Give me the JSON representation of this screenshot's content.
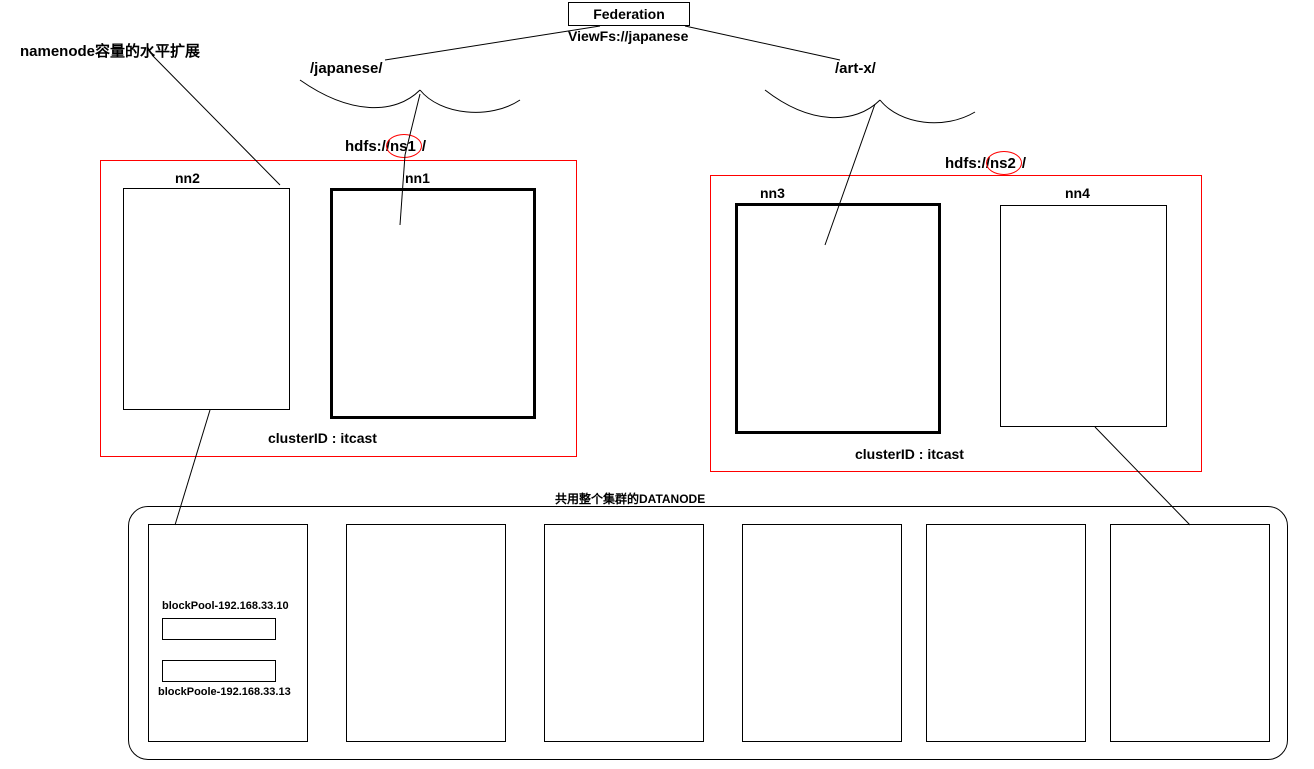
{
  "header": {
    "title": "Federation",
    "viewfs": "ViewFs://japanese"
  },
  "notes": {
    "namenode_expand": "namenode容量的水平扩展",
    "mount_left": "/japanese/",
    "mount_right": "/art-x/"
  },
  "clusters": {
    "left": {
      "hdfs_label_prefix": "hdfs://",
      "hdfs_ns": "ns1",
      "hdfs_label_suffix": "/",
      "nn_standby": "nn2",
      "nn_active": "nn1",
      "cluster_id": "clusterID   :   itcast"
    },
    "right": {
      "hdfs_label_prefix": "hdfs://",
      "hdfs_ns": "ns2",
      "hdfs_label_suffix": "/",
      "nn_active": "nn3",
      "nn_standby": "nn4",
      "cluster_id": "clusterID   :   itcast"
    }
  },
  "datanode": {
    "caption": "共用整个集群的DATANODE",
    "blockpool1": "blockPool-192.168.33.10",
    "blockpool2": "blockPoole-192.168.33.13"
  }
}
